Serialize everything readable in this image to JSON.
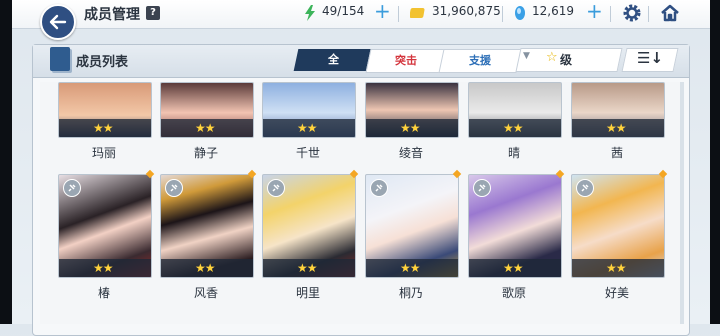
{
  "header": {
    "title": "成员管理",
    "help_icon_label": "?",
    "ap": "49/154",
    "credits": "31,960,875",
    "gems": "12,619"
  },
  "panel": {
    "title": "成员列表",
    "tabs": [
      "全",
      "突击",
      "支援"
    ],
    "sort_label": "级",
    "colors": {
      "active_tab": "#1f3a5c",
      "striker": "#d4343c",
      "special": "#2d6fb7"
    }
  },
  "characters_row1": [
    {
      "name": "玛丽",
      "stars": "★★"
    },
    {
      "name": "静子",
      "stars": "★★"
    },
    {
      "name": "千世",
      "stars": "★★"
    },
    {
      "name": "绫音",
      "stars": "★★"
    },
    {
      "name": "晴",
      "stars": "★★"
    },
    {
      "name": "茜",
      "stars": "★★"
    }
  ],
  "characters_row2": [
    {
      "name": "椿",
      "stars": "★★"
    },
    {
      "name": "风香",
      "stars": "★★"
    },
    {
      "name": "明里",
      "stars": "★★"
    },
    {
      "name": "桐乃",
      "stars": "★★"
    },
    {
      "name": "歌原",
      "stars": "★★"
    },
    {
      "name": "好美",
      "stars": "★★"
    }
  ]
}
